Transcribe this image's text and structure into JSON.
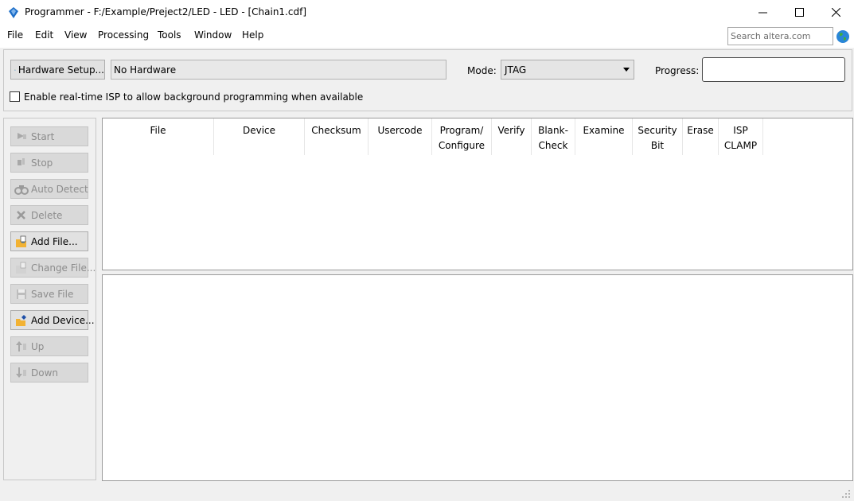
{
  "window": {
    "title": "Programmer - F:/Example/Preject2/LED - LED - [Chain1.cdf]",
    "minimize_glyph": "minimize-icon",
    "maximize_glyph": "maximize-icon",
    "close_glyph": "close-icon"
  },
  "menu": {
    "items": [
      {
        "label": "File"
      },
      {
        "label": "Edit"
      },
      {
        "label": "View"
      },
      {
        "label": "Processing"
      },
      {
        "label": "Tools"
      },
      {
        "label": "Window"
      },
      {
        "label": "Help"
      }
    ],
    "search_placeholder": "Search altera.com"
  },
  "hardware": {
    "setup_label": "Hardware Setup...",
    "current": "No Hardware",
    "mode_label": "Mode:",
    "mode_value": "JTAG",
    "progress_label": "Progress:",
    "isp_label": "Enable real-time ISP to allow background programming when available",
    "isp_checked": false
  },
  "side_buttons": [
    {
      "label": "Start",
      "enabled": false,
      "icon": "start-icon"
    },
    {
      "label": "Stop",
      "enabled": false,
      "icon": "stop-icon"
    },
    {
      "label": "Auto Detect",
      "enabled": false,
      "icon": "auto-detect-icon"
    },
    {
      "label": "Delete",
      "enabled": false,
      "icon": "delete-icon"
    },
    {
      "label": "Add File...",
      "enabled": true,
      "icon": "add-file-icon"
    },
    {
      "label": "Change File...",
      "enabled": false,
      "icon": "change-file-icon"
    },
    {
      "label": "Save File",
      "enabled": false,
      "icon": "save-file-icon"
    },
    {
      "label": "Add Device...",
      "enabled": true,
      "icon": "add-device-icon"
    },
    {
      "label": "Up",
      "enabled": false,
      "icon": "up-icon"
    },
    {
      "label": "Down",
      "enabled": false,
      "icon": "down-icon"
    }
  ],
  "table": {
    "columns": [
      {
        "line1": "File",
        "line2": ""
      },
      {
        "line1": "Device",
        "line2": ""
      },
      {
        "line1": "Checksum",
        "line2": ""
      },
      {
        "line1": "Usercode",
        "line2": ""
      },
      {
        "line1": "Program/",
        "line2": "Configure"
      },
      {
        "line1": "Verify",
        "line2": ""
      },
      {
        "line1": "Blank-",
        "line2": "Check"
      },
      {
        "line1": "Examine",
        "line2": ""
      },
      {
        "line1": "Security",
        "line2": "Bit"
      },
      {
        "line1": "Erase",
        "line2": ""
      },
      {
        "line1": "ISP",
        "line2": "CLAMP"
      }
    ],
    "rows": []
  },
  "colors": {
    "window_bg": "#f0f0f0",
    "panel_border": "#c8c8c8",
    "disabled_text": "#8c8c8c",
    "accent_blue": "#1e6fc8"
  }
}
